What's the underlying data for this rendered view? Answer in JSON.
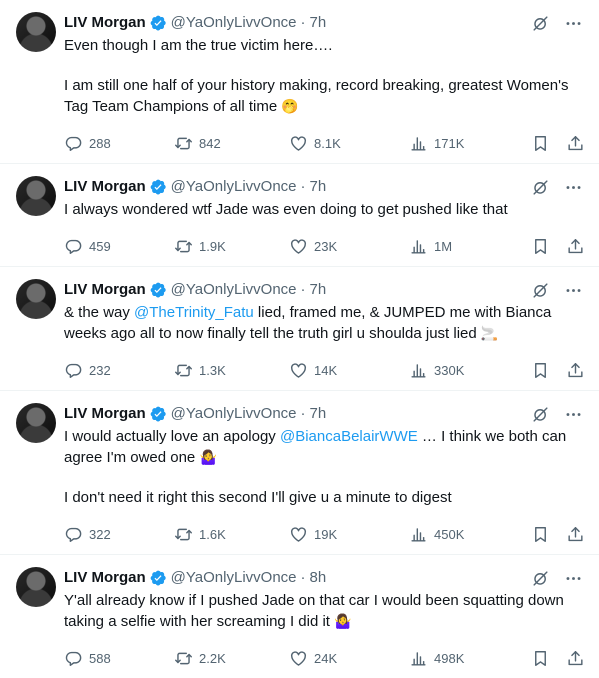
{
  "colors": {
    "accent": "#1d9bf0",
    "muted": "#536471",
    "text": "#0f1419",
    "divider": "#eff3f4"
  },
  "icons": {
    "verified": "verified-badge-icon",
    "grok": "grok-icon",
    "more": "more-icon",
    "reply": "reply-icon",
    "retweet": "retweet-icon",
    "like": "heart-icon",
    "views": "views-icon",
    "bookmark": "bookmark-icon",
    "share": "share-icon"
  },
  "tweets": [
    {
      "name": "LIV Morgan",
      "handle": "@YaOnlyLivvOnce",
      "dot": "·",
      "time": "7h",
      "paragraphs": [
        [
          {
            "text": "Even though I am the true victim here…."
          }
        ],
        [
          {
            "text": "I am still one half of your history making, record breaking, greatest Women's Tag Team Champions of all time "
          },
          {
            "text": "🤭",
            "emoji": true
          }
        ]
      ],
      "replies": "288",
      "retweets": "842",
      "likes": "8.1K",
      "views": "171K"
    },
    {
      "name": "LIV Morgan",
      "handle": "@YaOnlyLivvOnce",
      "dot": "·",
      "time": "7h",
      "paragraphs": [
        [
          {
            "text": "I always wondered wtf Jade was even doing to get pushed like that"
          }
        ]
      ],
      "replies": "459",
      "retweets": "1.9K",
      "likes": "23K",
      "views": "1M"
    },
    {
      "name": "LIV Morgan",
      "handle": "@YaOnlyLivvOnce",
      "dot": "·",
      "time": "7h",
      "paragraphs": [
        [
          {
            "text": "& the way "
          },
          {
            "text": "@TheTrinity_Fatu",
            "mention": true
          },
          {
            "text": " lied, framed me, & JUMPED me with Bianca weeks ago  all to now finally tell the truth girl u shoulda just lied "
          },
          {
            "text": "🚬",
            "emoji": true
          }
        ]
      ],
      "replies": "232",
      "retweets": "1.3K",
      "likes": "14K",
      "views": "330K"
    },
    {
      "name": "LIV Morgan",
      "handle": "@YaOnlyLivvOnce",
      "dot": "·",
      "time": "7h",
      "paragraphs": [
        [
          {
            "text": "I would actually love an apology "
          },
          {
            "text": "@BiancaBelairWWE",
            "mention": true
          },
          {
            "text": " … I think we both can agree I'm owed one "
          },
          {
            "text": "🤷‍♀️",
            "emoji": true
          }
        ],
        [
          {
            "text": "I don't need it right this second I'll give u a minute to digest"
          }
        ]
      ],
      "replies": "322",
      "retweets": "1.6K",
      "likes": "19K",
      "views": "450K"
    },
    {
      "name": "LIV Morgan",
      "handle": "@YaOnlyLivvOnce",
      "dot": "·",
      "time": "8h",
      "paragraphs": [
        [
          {
            "text": "Y'all already know if I pushed Jade on that car I would been squatting down taking a selfie with her screaming I did it "
          },
          {
            "text": "🤷‍♀️",
            "emoji": true
          }
        ]
      ],
      "replies": "588",
      "retweets": "2.2K",
      "likes": "24K",
      "views": "498K"
    }
  ]
}
